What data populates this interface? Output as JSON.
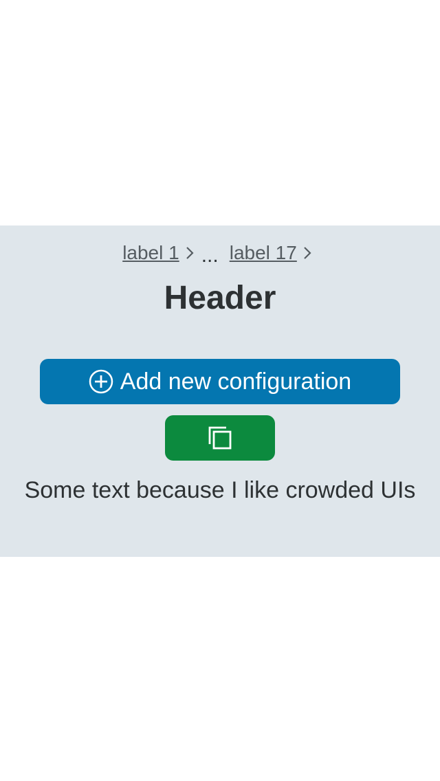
{
  "breadcrumb": {
    "items": [
      {
        "label": "label 1"
      },
      {
        "label": "label 17"
      }
    ],
    "ellipsis": "..."
  },
  "header": {
    "title": "Header"
  },
  "actions": {
    "add_label": "Add new configuration",
    "add_icon": "plus-circle-icon",
    "copy_icon": "copy-icon"
  },
  "note": {
    "text": "Some text because I like crowded UIs"
  },
  "colors": {
    "panel_bg": "#dfe6eb",
    "primary": "#0476b0",
    "success": "#0c8a3e",
    "text": "#2d3133"
  }
}
